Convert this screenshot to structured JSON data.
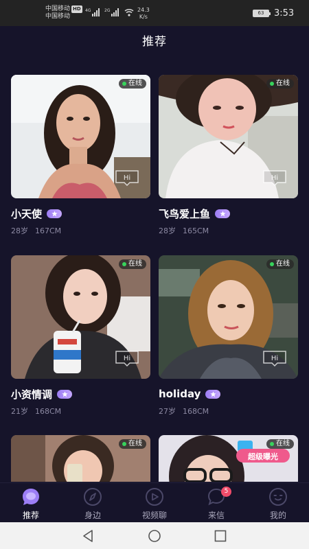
{
  "status_bar": {
    "carrier1": "中国移动",
    "hd": "HD",
    "carrier2": "中国移动",
    "net1": "4G",
    "net2": "2G",
    "speed_value": "24.3",
    "speed_unit": "K/s",
    "battery": "63",
    "time": "3:53"
  },
  "header": {
    "title": "推荐"
  },
  "cards": [
    {
      "name": "小天使",
      "age": "28岁",
      "height": "167CM",
      "online": "在线",
      "hi": "Hi"
    },
    {
      "name": "飞鸟爱上鱼",
      "age": "28岁",
      "height": "165CM",
      "online": "在线",
      "hi": "Hi"
    },
    {
      "name": "小资情调",
      "age": "21岁",
      "height": "168CM",
      "online": "在线",
      "hi": "Hi"
    },
    {
      "name": "holiday",
      "age": "27岁",
      "height": "168CM",
      "online": "在线",
      "hi": "Hi"
    },
    {
      "online": "在线"
    },
    {
      "online": "在线",
      "promo_text": "超级曝光"
    }
  ],
  "tabs": [
    {
      "label": "推荐",
      "icon": "recommend-icon",
      "active": true
    },
    {
      "label": "身边",
      "icon": "compass-icon"
    },
    {
      "label": "视频聊",
      "icon": "video-chat-icon"
    },
    {
      "label": "来信",
      "icon": "message-icon",
      "badge": "5"
    },
    {
      "label": "我的",
      "icon": "profile-icon"
    }
  ],
  "colors": {
    "background": "#16142a",
    "vip_badge": "#a98af5",
    "online_dot": "#38d35c",
    "badge": "#f04c6a"
  }
}
